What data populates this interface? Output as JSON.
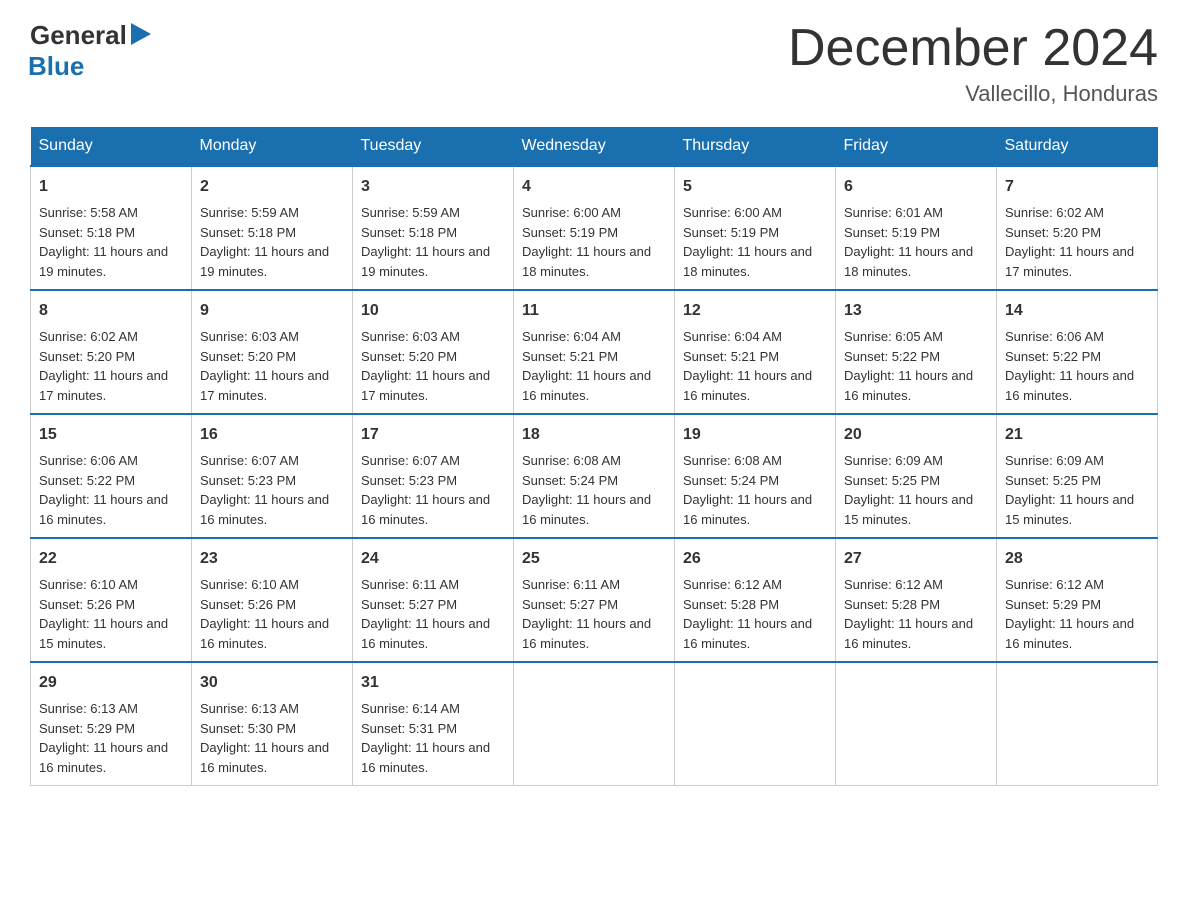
{
  "header": {
    "logo_text": "General",
    "logo_blue": "Blue",
    "month_title": "December 2024",
    "location": "Vallecillo, Honduras"
  },
  "weekdays": [
    "Sunday",
    "Monday",
    "Tuesday",
    "Wednesday",
    "Thursday",
    "Friday",
    "Saturday"
  ],
  "weeks": [
    [
      {
        "day": "1",
        "sunrise": "5:58 AM",
        "sunset": "5:18 PM",
        "daylight": "11 hours and 19 minutes."
      },
      {
        "day": "2",
        "sunrise": "5:59 AM",
        "sunset": "5:18 PM",
        "daylight": "11 hours and 19 minutes."
      },
      {
        "day": "3",
        "sunrise": "5:59 AM",
        "sunset": "5:18 PM",
        "daylight": "11 hours and 19 minutes."
      },
      {
        "day": "4",
        "sunrise": "6:00 AM",
        "sunset": "5:19 PM",
        "daylight": "11 hours and 18 minutes."
      },
      {
        "day": "5",
        "sunrise": "6:00 AM",
        "sunset": "5:19 PM",
        "daylight": "11 hours and 18 minutes."
      },
      {
        "day": "6",
        "sunrise": "6:01 AM",
        "sunset": "5:19 PM",
        "daylight": "11 hours and 18 minutes."
      },
      {
        "day": "7",
        "sunrise": "6:02 AM",
        "sunset": "5:20 PM",
        "daylight": "11 hours and 17 minutes."
      }
    ],
    [
      {
        "day": "8",
        "sunrise": "6:02 AM",
        "sunset": "5:20 PM",
        "daylight": "11 hours and 17 minutes."
      },
      {
        "day": "9",
        "sunrise": "6:03 AM",
        "sunset": "5:20 PM",
        "daylight": "11 hours and 17 minutes."
      },
      {
        "day": "10",
        "sunrise": "6:03 AM",
        "sunset": "5:20 PM",
        "daylight": "11 hours and 17 minutes."
      },
      {
        "day": "11",
        "sunrise": "6:04 AM",
        "sunset": "5:21 PM",
        "daylight": "11 hours and 16 minutes."
      },
      {
        "day": "12",
        "sunrise": "6:04 AM",
        "sunset": "5:21 PM",
        "daylight": "11 hours and 16 minutes."
      },
      {
        "day": "13",
        "sunrise": "6:05 AM",
        "sunset": "5:22 PM",
        "daylight": "11 hours and 16 minutes."
      },
      {
        "day": "14",
        "sunrise": "6:06 AM",
        "sunset": "5:22 PM",
        "daylight": "11 hours and 16 minutes."
      }
    ],
    [
      {
        "day": "15",
        "sunrise": "6:06 AM",
        "sunset": "5:22 PM",
        "daylight": "11 hours and 16 minutes."
      },
      {
        "day": "16",
        "sunrise": "6:07 AM",
        "sunset": "5:23 PM",
        "daylight": "11 hours and 16 minutes."
      },
      {
        "day": "17",
        "sunrise": "6:07 AM",
        "sunset": "5:23 PM",
        "daylight": "11 hours and 16 minutes."
      },
      {
        "day": "18",
        "sunrise": "6:08 AM",
        "sunset": "5:24 PM",
        "daylight": "11 hours and 16 minutes."
      },
      {
        "day": "19",
        "sunrise": "6:08 AM",
        "sunset": "5:24 PM",
        "daylight": "11 hours and 16 minutes."
      },
      {
        "day": "20",
        "sunrise": "6:09 AM",
        "sunset": "5:25 PM",
        "daylight": "11 hours and 15 minutes."
      },
      {
        "day": "21",
        "sunrise": "6:09 AM",
        "sunset": "5:25 PM",
        "daylight": "11 hours and 15 minutes."
      }
    ],
    [
      {
        "day": "22",
        "sunrise": "6:10 AM",
        "sunset": "5:26 PM",
        "daylight": "11 hours and 15 minutes."
      },
      {
        "day": "23",
        "sunrise": "6:10 AM",
        "sunset": "5:26 PM",
        "daylight": "11 hours and 16 minutes."
      },
      {
        "day": "24",
        "sunrise": "6:11 AM",
        "sunset": "5:27 PM",
        "daylight": "11 hours and 16 minutes."
      },
      {
        "day": "25",
        "sunrise": "6:11 AM",
        "sunset": "5:27 PM",
        "daylight": "11 hours and 16 minutes."
      },
      {
        "day": "26",
        "sunrise": "6:12 AM",
        "sunset": "5:28 PM",
        "daylight": "11 hours and 16 minutes."
      },
      {
        "day": "27",
        "sunrise": "6:12 AM",
        "sunset": "5:28 PM",
        "daylight": "11 hours and 16 minutes."
      },
      {
        "day": "28",
        "sunrise": "6:12 AM",
        "sunset": "5:29 PM",
        "daylight": "11 hours and 16 minutes."
      }
    ],
    [
      {
        "day": "29",
        "sunrise": "6:13 AM",
        "sunset": "5:29 PM",
        "daylight": "11 hours and 16 minutes."
      },
      {
        "day": "30",
        "sunrise": "6:13 AM",
        "sunset": "5:30 PM",
        "daylight": "11 hours and 16 minutes."
      },
      {
        "day": "31",
        "sunrise": "6:14 AM",
        "sunset": "5:31 PM",
        "daylight": "11 hours and 16 minutes."
      },
      null,
      null,
      null,
      null
    ]
  ]
}
